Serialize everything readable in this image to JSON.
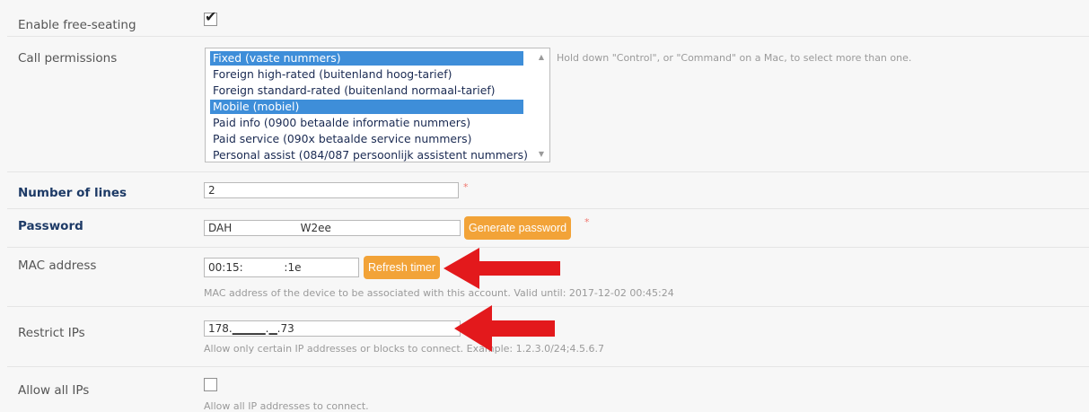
{
  "form": {
    "free_seating": {
      "label": "Enable free-seating",
      "checkbox_mark": "✔"
    },
    "call_permissions": {
      "label": "Call permissions",
      "help": "Hold down \"Control\", or \"Command\" on a Mac, to select more than one.",
      "options": [
        {
          "text": "Fixed (vaste nummers)",
          "selected": true
        },
        {
          "text": "Foreign high-rated (buitenland hoog-tarief)",
          "selected": false
        },
        {
          "text": "Foreign standard-rated (buitenland normaal-tarief)",
          "selected": false
        },
        {
          "text": "Mobile (mobiel)",
          "selected": true
        },
        {
          "text": "Paid info (0900 betaalde informatie nummers)",
          "selected": false
        },
        {
          "text": "Paid service (090x betaalde service nummers)",
          "selected": false
        },
        {
          "text": "Personal assist (084/087 persoonlijk assistent nummers)",
          "selected": false
        }
      ],
      "scroll_up": "▲",
      "scroll_down": "▼"
    },
    "number_of_lines": {
      "label": "Number of lines",
      "value": "2",
      "required_mark": "*"
    },
    "password": {
      "label": "Password",
      "value": "DAH          W2ee",
      "button": "Generate password",
      "required_mark": "*"
    },
    "mac_address": {
      "label": "MAC address",
      "value": "00:15:      :1e",
      "button": "Refresh timer",
      "help": "MAC address of the device to be associated with this account. Valid until: 2017-12-02 00:45:24"
    },
    "restrict_ips": {
      "label": "Restrict IPs",
      "value": "178.▁▁▁▁.▁.73",
      "help": "Allow only certain IP addresses or blocks to connect. Example: 1.2.3.0/24;4.5.6.7"
    },
    "allow_all_ips": {
      "label": "Allow all IPs",
      "help": "Allow all IP addresses to connect."
    }
  },
  "annotation_color": "#e3191c"
}
